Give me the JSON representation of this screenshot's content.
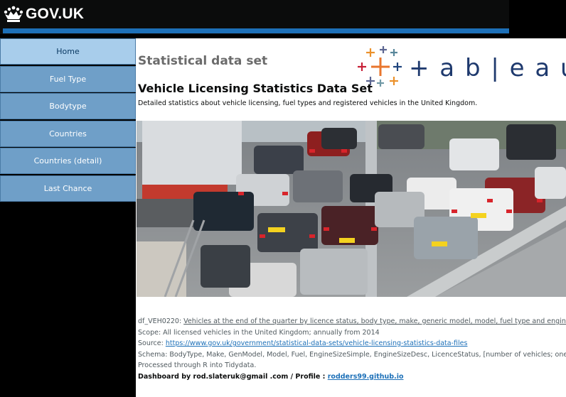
{
  "header": {
    "logo_text": "GOV.UK"
  },
  "sidebar": {
    "items": [
      {
        "label": "Home"
      },
      {
        "label": "Fuel Type"
      },
      {
        "label": "Bodytype"
      },
      {
        "label": "Countries"
      },
      {
        "label": "Countries (detail)"
      },
      {
        "label": "Last Chance"
      }
    ]
  },
  "main": {
    "statistical_label": "Statistical data set",
    "tableau_wordmark": "+ a b | e a u",
    "title": "Vehicle Licensing Statistics Data Set",
    "description": "Detailed statistics about vehicle licensing, fuel types and registered vehicles in the United Kingdom.",
    "meta": {
      "id_prefix": "df_VEH0220: ",
      "id_link": "Vehicles at the end of the quarter by licence status, body type, make, generic model, model, fuel type and engine size: United Kingdom",
      "scope": "Scope: All licensed vehicles in the United Kingdom; annually from 2014",
      "source_prefix": "Source: ",
      "source_link": "https://www.gov.uk/government/statistical-data-sets/vehicle-licensing-statistics-data-files",
      "schema": "Schema: BodyType, Make, GenModel, Model, Fuel, EngineSizeSimple, EngineSizeDesc, LicenceStatus, [number of vehicles; one column per quarter]",
      "processed": "Processed through R into Tidydata.",
      "credit_prefix": "Dashboard by rod.slateruk@gmail .com / Profile : ",
      "credit_link": "rodders99.github.io"
    }
  },
  "colors": {
    "header_bg": "#0b0c0c",
    "header_stripe": "#1d70b8",
    "nav_bg": "#6f9fc8",
    "nav_active_bg": "#a8cdeb",
    "link_blue": "#1d70b8",
    "tableau_navy": "#1f3a6e"
  }
}
